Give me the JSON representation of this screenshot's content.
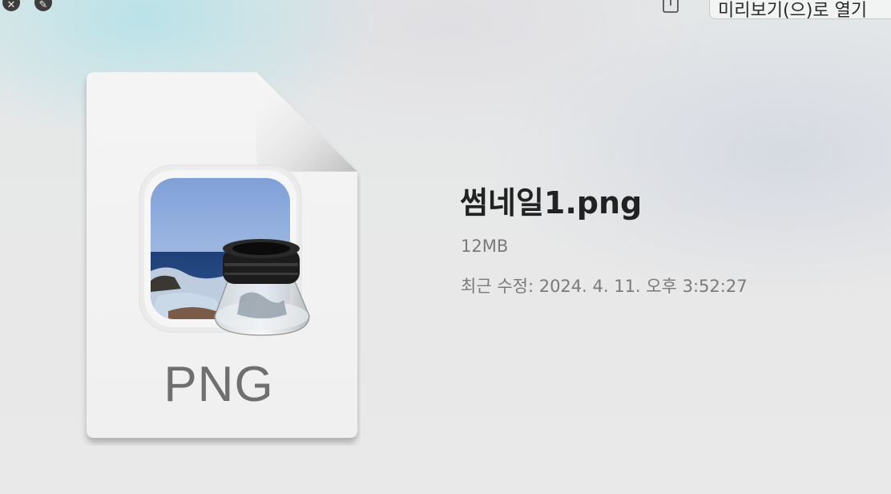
{
  "toolbar": {
    "close_icon": "close-icon",
    "edit_icon": "pencil-icon",
    "share_icon": "share-icon",
    "open_with_label": "미리보기(으)로 열기"
  },
  "preview": {
    "type_label": "PNG",
    "app_icon": "preview-app-icon"
  },
  "file": {
    "name": "썸네일1.png",
    "size": "12MB",
    "modified": "최근 수정: 2024. 4. 11. 오후 3:52:27"
  }
}
